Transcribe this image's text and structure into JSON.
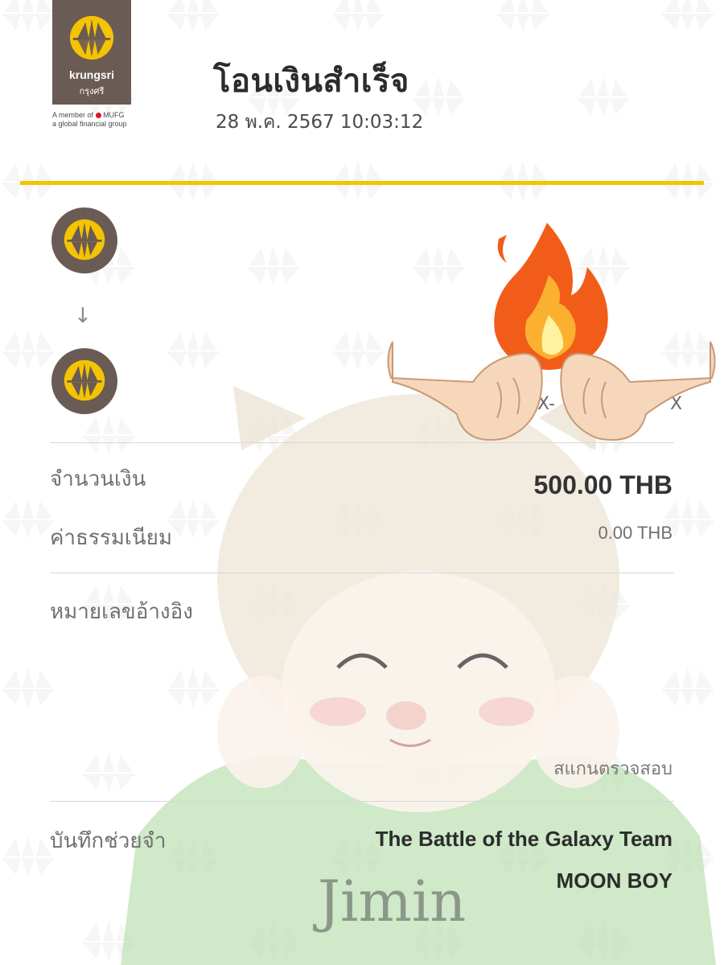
{
  "brand": {
    "name": "krungsri",
    "name_th": "กรุงศรี",
    "tagline_line1": "A member of",
    "tagline_group": "MUFG",
    "tagline_line2": "a global financial group",
    "colors": {
      "primary": "#6b5b55",
      "accent": "#f5c400",
      "mufg_red": "#d71920"
    }
  },
  "header": {
    "title": "โอนเงินสำเร็จ",
    "timestamp": "28 พ.ค. 2567 10:03:12"
  },
  "transfer": {
    "from_icon": "krungsri-logo-icon",
    "arrow_icon": "arrow-down-icon",
    "to_icon": "krungsri-logo-icon",
    "to_account_masked_start": "X-",
    "to_account_masked_end": "X"
  },
  "details": {
    "amount_label": "จำนวนเงิน",
    "amount_value": "500.00 THB",
    "fee_label": "ค่าธรรมเนียม",
    "fee_value": "0.00 THB",
    "reference_label": "หมายเลขอ้างอิง",
    "scan_label": "สแกนตรวจสอบ",
    "memo_label": "บันทึกช่วยจำ",
    "memo_line1": "The Battle of the Galaxy Team",
    "memo_line2": "MOON BOY"
  },
  "decorations": {
    "stickers": [
      "fire-icon",
      "fist-bump-icon",
      "cartoon-character-illustration"
    ],
    "character_caption": "Jimin"
  }
}
